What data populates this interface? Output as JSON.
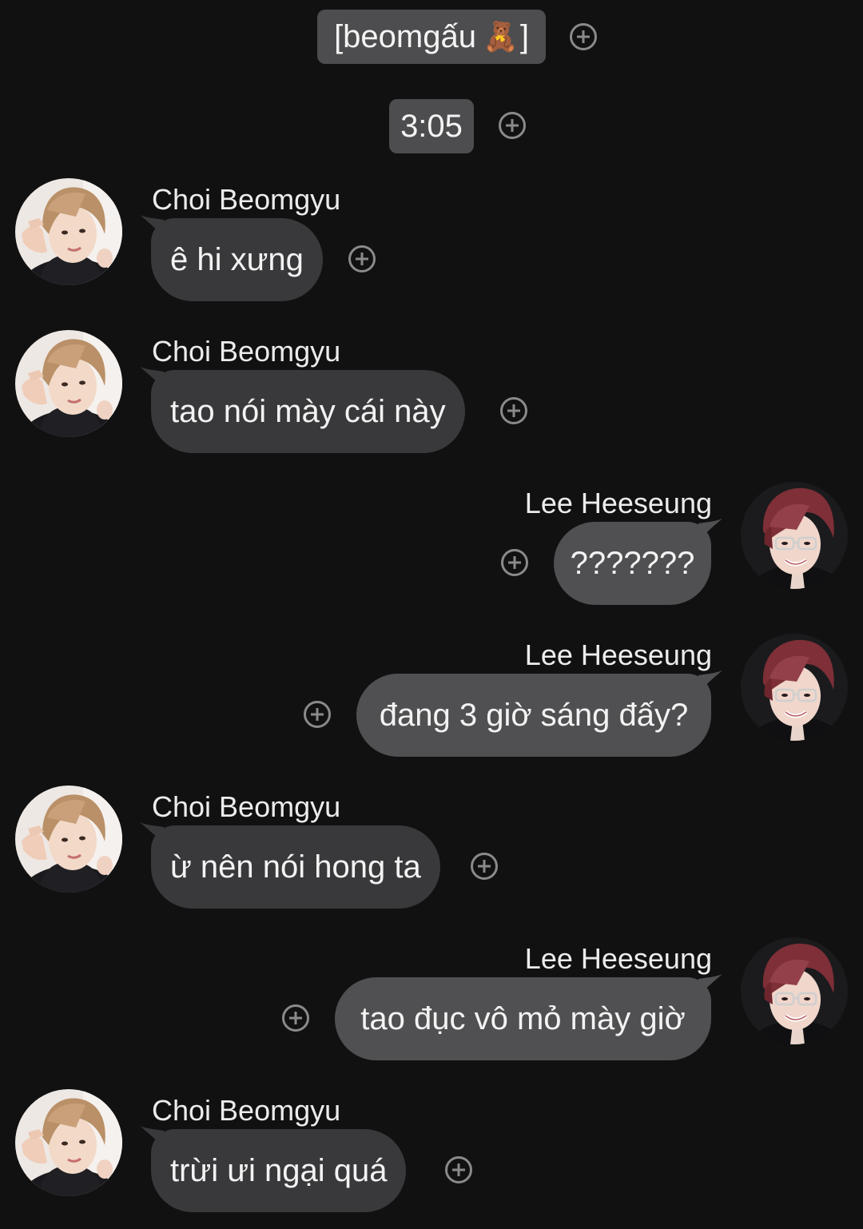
{
  "chat": {
    "title_text": "[beomgấu",
    "title_emoji": "🧸",
    "title_close": "]",
    "time": "3:05"
  },
  "messages": [
    {
      "sender": "Choi Beomgyu",
      "text": "ê hi xưng"
    },
    {
      "sender": "Choi Beomgyu",
      "text": "tao nói mày cái này"
    },
    {
      "sender": "Lee Heeseung",
      "text": "???????"
    },
    {
      "sender": "Lee Heeseung",
      "text": "đang 3 giờ sáng đấy?"
    },
    {
      "sender": "Choi Beomgyu",
      "text": "ừ nên nói hong ta"
    },
    {
      "sender": "Lee Heeseung",
      "text": "tao đục vô mỏ mày giờ"
    },
    {
      "sender": "Choi Beomgyu",
      "text": "trừi ưi ngại quá"
    }
  ],
  "colors": {
    "background": "#111112",
    "bubble_other": "#39393b",
    "bubble_mine": "#505052",
    "pill": "#4d4d4f"
  },
  "icons": {
    "add": "plus-circle-icon",
    "emoji": "teddy-bear-emoji"
  }
}
